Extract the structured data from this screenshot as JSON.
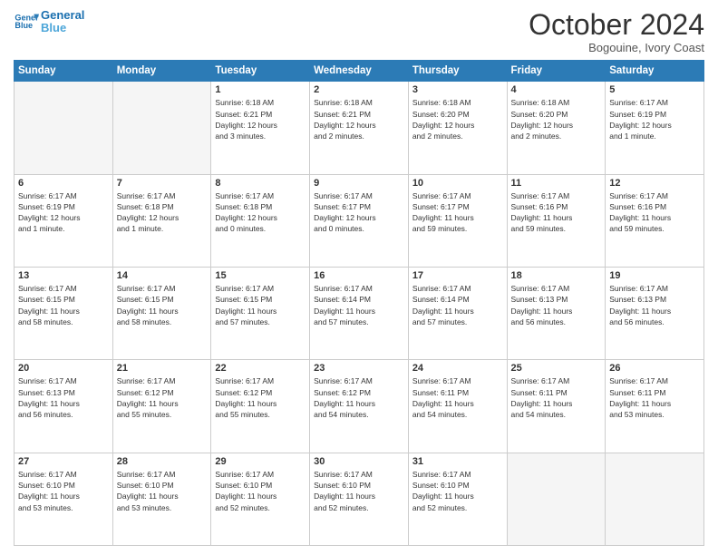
{
  "header": {
    "logo_line1": "General",
    "logo_line2": "Blue",
    "month": "October 2024",
    "location": "Bogouine, Ivory Coast"
  },
  "weekdays": [
    "Sunday",
    "Monday",
    "Tuesday",
    "Wednesday",
    "Thursday",
    "Friday",
    "Saturday"
  ],
  "weeks": [
    [
      {
        "day": "",
        "info": ""
      },
      {
        "day": "",
        "info": ""
      },
      {
        "day": "1",
        "info": "Sunrise: 6:18 AM\nSunset: 6:21 PM\nDaylight: 12 hours\nand 3 minutes."
      },
      {
        "day": "2",
        "info": "Sunrise: 6:18 AM\nSunset: 6:21 PM\nDaylight: 12 hours\nand 2 minutes."
      },
      {
        "day": "3",
        "info": "Sunrise: 6:18 AM\nSunset: 6:20 PM\nDaylight: 12 hours\nand 2 minutes."
      },
      {
        "day": "4",
        "info": "Sunrise: 6:18 AM\nSunset: 6:20 PM\nDaylight: 12 hours\nand 2 minutes."
      },
      {
        "day": "5",
        "info": "Sunrise: 6:17 AM\nSunset: 6:19 PM\nDaylight: 12 hours\nand 1 minute."
      }
    ],
    [
      {
        "day": "6",
        "info": "Sunrise: 6:17 AM\nSunset: 6:19 PM\nDaylight: 12 hours\nand 1 minute."
      },
      {
        "day": "7",
        "info": "Sunrise: 6:17 AM\nSunset: 6:18 PM\nDaylight: 12 hours\nand 1 minute."
      },
      {
        "day": "8",
        "info": "Sunrise: 6:17 AM\nSunset: 6:18 PM\nDaylight: 12 hours\nand 0 minutes."
      },
      {
        "day": "9",
        "info": "Sunrise: 6:17 AM\nSunset: 6:17 PM\nDaylight: 12 hours\nand 0 minutes."
      },
      {
        "day": "10",
        "info": "Sunrise: 6:17 AM\nSunset: 6:17 PM\nDaylight: 11 hours\nand 59 minutes."
      },
      {
        "day": "11",
        "info": "Sunrise: 6:17 AM\nSunset: 6:16 PM\nDaylight: 11 hours\nand 59 minutes."
      },
      {
        "day": "12",
        "info": "Sunrise: 6:17 AM\nSunset: 6:16 PM\nDaylight: 11 hours\nand 59 minutes."
      }
    ],
    [
      {
        "day": "13",
        "info": "Sunrise: 6:17 AM\nSunset: 6:15 PM\nDaylight: 11 hours\nand 58 minutes."
      },
      {
        "day": "14",
        "info": "Sunrise: 6:17 AM\nSunset: 6:15 PM\nDaylight: 11 hours\nand 58 minutes."
      },
      {
        "day": "15",
        "info": "Sunrise: 6:17 AM\nSunset: 6:15 PM\nDaylight: 11 hours\nand 57 minutes."
      },
      {
        "day": "16",
        "info": "Sunrise: 6:17 AM\nSunset: 6:14 PM\nDaylight: 11 hours\nand 57 minutes."
      },
      {
        "day": "17",
        "info": "Sunrise: 6:17 AM\nSunset: 6:14 PM\nDaylight: 11 hours\nand 57 minutes."
      },
      {
        "day": "18",
        "info": "Sunrise: 6:17 AM\nSunset: 6:13 PM\nDaylight: 11 hours\nand 56 minutes."
      },
      {
        "day": "19",
        "info": "Sunrise: 6:17 AM\nSunset: 6:13 PM\nDaylight: 11 hours\nand 56 minutes."
      }
    ],
    [
      {
        "day": "20",
        "info": "Sunrise: 6:17 AM\nSunset: 6:13 PM\nDaylight: 11 hours\nand 56 minutes."
      },
      {
        "day": "21",
        "info": "Sunrise: 6:17 AM\nSunset: 6:12 PM\nDaylight: 11 hours\nand 55 minutes."
      },
      {
        "day": "22",
        "info": "Sunrise: 6:17 AM\nSunset: 6:12 PM\nDaylight: 11 hours\nand 55 minutes."
      },
      {
        "day": "23",
        "info": "Sunrise: 6:17 AM\nSunset: 6:12 PM\nDaylight: 11 hours\nand 54 minutes."
      },
      {
        "day": "24",
        "info": "Sunrise: 6:17 AM\nSunset: 6:11 PM\nDaylight: 11 hours\nand 54 minutes."
      },
      {
        "day": "25",
        "info": "Sunrise: 6:17 AM\nSunset: 6:11 PM\nDaylight: 11 hours\nand 54 minutes."
      },
      {
        "day": "26",
        "info": "Sunrise: 6:17 AM\nSunset: 6:11 PM\nDaylight: 11 hours\nand 53 minutes."
      }
    ],
    [
      {
        "day": "27",
        "info": "Sunrise: 6:17 AM\nSunset: 6:10 PM\nDaylight: 11 hours\nand 53 minutes."
      },
      {
        "day": "28",
        "info": "Sunrise: 6:17 AM\nSunset: 6:10 PM\nDaylight: 11 hours\nand 53 minutes."
      },
      {
        "day": "29",
        "info": "Sunrise: 6:17 AM\nSunset: 6:10 PM\nDaylight: 11 hours\nand 52 minutes."
      },
      {
        "day": "30",
        "info": "Sunrise: 6:17 AM\nSunset: 6:10 PM\nDaylight: 11 hours\nand 52 minutes."
      },
      {
        "day": "31",
        "info": "Sunrise: 6:17 AM\nSunset: 6:10 PM\nDaylight: 11 hours\nand 52 minutes."
      },
      {
        "day": "",
        "info": ""
      },
      {
        "day": "",
        "info": ""
      }
    ]
  ]
}
